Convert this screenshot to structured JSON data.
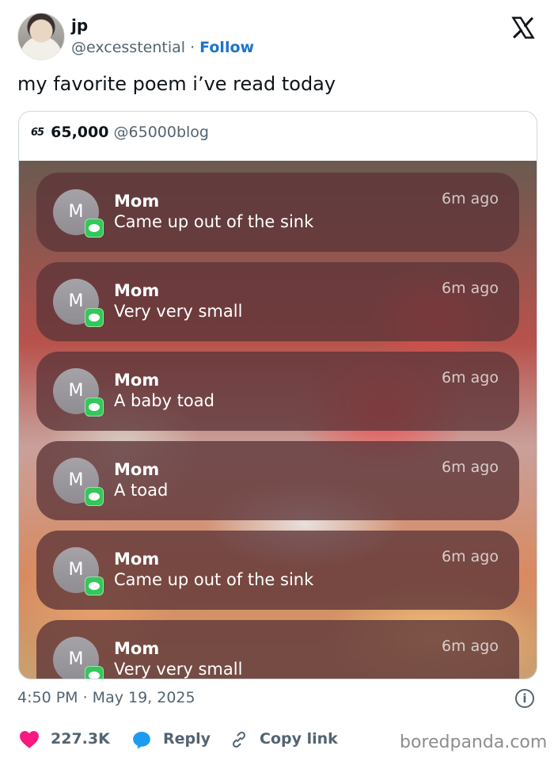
{
  "author": {
    "name": "jp",
    "handle": "@excesstential",
    "separator": "·",
    "follow_label": "Follow"
  },
  "tweet": {
    "text": "my favorite poem i’ve read today",
    "timestamp": "4:50 PM · May 19, 2025"
  },
  "quote": {
    "logo_text": "65",
    "name": "65,000",
    "handle": "@65000blog",
    "notifications": [
      {
        "avatar_letter": "M",
        "sender": "Mom",
        "text": "Came up out of the sink",
        "time": "6m ago"
      },
      {
        "avatar_letter": "M",
        "sender": "Mom",
        "text": "Very very small",
        "time": "6m ago"
      },
      {
        "avatar_letter": "M",
        "sender": "Mom",
        "text": "A baby toad",
        "time": "6m ago"
      },
      {
        "avatar_letter": "M",
        "sender": "Mom",
        "text": "A toad",
        "time": "6m ago"
      },
      {
        "avatar_letter": "M",
        "sender": "Mom",
        "text": "Came up out of the sink",
        "time": "6m ago"
      },
      {
        "avatar_letter": "M",
        "sender": "Mom",
        "text": "Very very small",
        "time": "6m ago"
      }
    ]
  },
  "actions": {
    "likes": "227.3K",
    "reply_label": "Reply",
    "copy_label": "Copy link"
  },
  "watermark": "boredpanda.com",
  "colors": {
    "follow": "#1d74c9",
    "heart": "#f91880",
    "reply_icon": "#1d9bf0",
    "badge": "#34c759"
  }
}
